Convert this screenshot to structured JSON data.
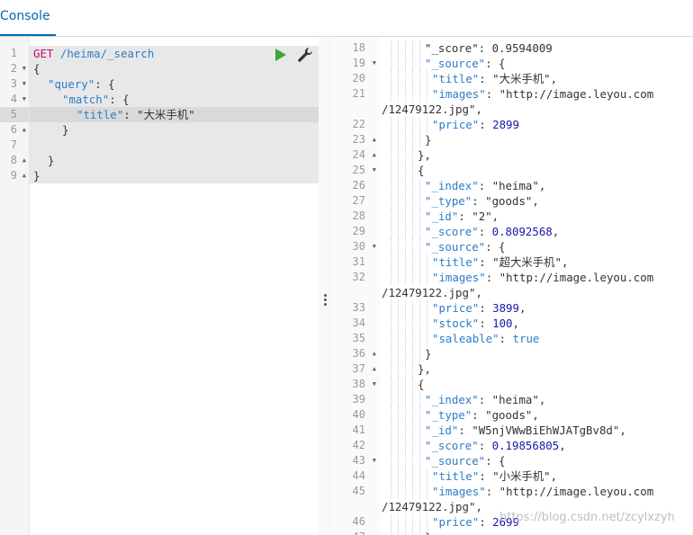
{
  "tabs": {
    "console": "Console"
  },
  "request": {
    "method": "GET",
    "path": "/heima/_search",
    "lines": [
      {
        "n": "1",
        "fold": ""
      },
      {
        "n": "2",
        "fold": "▼"
      },
      {
        "n": "3",
        "fold": "▼"
      },
      {
        "n": "4",
        "fold": "▼"
      },
      {
        "n": "5",
        "fold": ""
      },
      {
        "n": "6",
        "fold": "▲"
      },
      {
        "n": "7",
        "fold": ""
      },
      {
        "n": "8",
        "fold": "▲"
      },
      {
        "n": "9",
        "fold": "▲"
      }
    ],
    "code": {
      "l2": "{",
      "l3_key": "\"query\"",
      "l3_rest": ": {",
      "l4_key": "\"match\"",
      "l4_rest": ": {",
      "l5_key": "\"title\"",
      "l5_colon": ": ",
      "l5_val": "\"大米手机\"",
      "l6": "}",
      "l8": "}",
      "l9": "}"
    }
  },
  "response": {
    "lines": [
      {
        "n": "18",
        "fold": "",
        "text": "\"_score\": 0.9594009"
      },
      {
        "n": "19",
        "fold": "▼",
        "key": "\"_source\"",
        "rest": ": {"
      },
      {
        "n": "20",
        "fold": "",
        "key": "\"title\"",
        "sep": ": ",
        "val": "\"大米手机\"",
        "end": ","
      },
      {
        "n": "21",
        "fold": "",
        "key": "\"images\"",
        "sep": ": ",
        "val": "\"http://image.leyou.com",
        "end": ""
      },
      {
        "n": "",
        "fold": "",
        "val": "/12479122.jpg\"",
        "end": ","
      },
      {
        "n": "22",
        "fold": "",
        "key": "\"price\"",
        "sep": ": ",
        "num": "2899",
        "end": ""
      },
      {
        "n": "23",
        "fold": "▲",
        "text": "}"
      },
      {
        "n": "24",
        "fold": "▲",
        "text": "},"
      },
      {
        "n": "25",
        "fold": "▼",
        "text": "{"
      },
      {
        "n": "26",
        "fold": "",
        "key": "\"_index\"",
        "sep": ": ",
        "val": "\"heima\"",
        "end": ","
      },
      {
        "n": "27",
        "fold": "",
        "key": "\"_type\"",
        "sep": ": ",
        "val": "\"goods\"",
        "end": ","
      },
      {
        "n": "28",
        "fold": "",
        "key": "\"_id\"",
        "sep": ": ",
        "val": "\"2\"",
        "end": ","
      },
      {
        "n": "29",
        "fold": "",
        "key": "\"_score\"",
        "sep": ": ",
        "num": "0.8092568",
        "end": ","
      },
      {
        "n": "30",
        "fold": "▼",
        "key": "\"_source\"",
        "rest": ": {"
      },
      {
        "n": "31",
        "fold": "",
        "key": "\"title\"",
        "sep": ": ",
        "val": "\"超大米手机\"",
        "end": ","
      },
      {
        "n": "32",
        "fold": "",
        "key": "\"images\"",
        "sep": ": ",
        "val": "\"http://image.leyou.com",
        "end": ""
      },
      {
        "n": "",
        "fold": "",
        "val": "/12479122.jpg\"",
        "end": ","
      },
      {
        "n": "33",
        "fold": "",
        "key": "\"price\"",
        "sep": ": ",
        "num": "3899",
        "end": ","
      },
      {
        "n": "34",
        "fold": "",
        "key": "\"stock\"",
        "sep": ": ",
        "num": "100",
        "end": ","
      },
      {
        "n": "35",
        "fold": "",
        "key": "\"saleable\"",
        "sep": ": ",
        "bool": "true",
        "end": ""
      },
      {
        "n": "36",
        "fold": "▲",
        "text": "}"
      },
      {
        "n": "37",
        "fold": "▲",
        "text": "},"
      },
      {
        "n": "38",
        "fold": "▼",
        "text": "{"
      },
      {
        "n": "39",
        "fold": "",
        "key": "\"_index\"",
        "sep": ": ",
        "val": "\"heima\"",
        "end": ","
      },
      {
        "n": "40",
        "fold": "",
        "key": "\"_type\"",
        "sep": ": ",
        "val": "\"goods\"",
        "end": ","
      },
      {
        "n": "41",
        "fold": "",
        "key": "\"_id\"",
        "sep": ": ",
        "val": "\"W5njVWwBiEhWJATgBv8d\"",
        "end": ","
      },
      {
        "n": "42",
        "fold": "",
        "key": "\"_score\"",
        "sep": ": ",
        "num": "0.19856805",
        "end": ","
      },
      {
        "n": "43",
        "fold": "▼",
        "key": "\"_source\"",
        "rest": ": {"
      },
      {
        "n": "44",
        "fold": "",
        "key": "\"title\"",
        "sep": ": ",
        "val": "\"小米手机\"",
        "end": ","
      },
      {
        "n": "45",
        "fold": "",
        "key": "\"images\"",
        "sep": ": ",
        "val": "\"http://image.leyou.com",
        "end": ""
      },
      {
        "n": "",
        "fold": "",
        "val": "/12479122.jpg\"",
        "end": ","
      },
      {
        "n": "46",
        "fold": "",
        "key": "\"price\"",
        "sep": ": ",
        "num": "2699",
        "end": ""
      },
      {
        "n": "47",
        "fold": "▲",
        "text": "}"
      }
    ]
  },
  "watermark": "https://blog.csdn.net/zcylxzyh",
  "colors": {
    "accent": "#006bb4",
    "method": "#c80a68",
    "play": "#3fa540"
  }
}
